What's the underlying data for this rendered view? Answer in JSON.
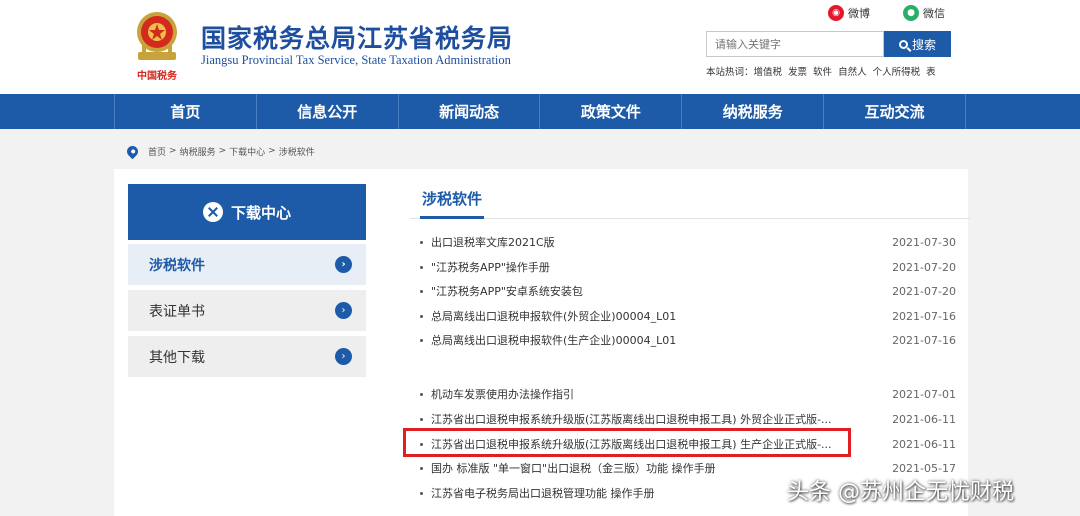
{
  "header": {
    "title": "国家税务总局江苏省税务局",
    "subtitle": "Jiangsu Provincial Tax Service, State Taxation Administration",
    "logo_text": "中国税务",
    "social": [
      {
        "label": "微博",
        "icon": "weibo-icon",
        "color": "#e6162d"
      },
      {
        "label": "微信",
        "icon": "wechat-icon",
        "color": "#2aae67"
      }
    ]
  },
  "search": {
    "placeholder": "请输入关键字",
    "button_label": "搜索",
    "hot_label": "本站热词：",
    "hot_words": [
      "增值税",
      "发票",
      "软件",
      "自然人",
      "个人所得税",
      "表"
    ]
  },
  "nav": {
    "items": [
      "首页",
      "信息公开",
      "新闻动态",
      "政策文件",
      "纳税服务",
      "互动交流"
    ]
  },
  "breadcrumb": {
    "items": [
      "首页",
      "纳税服务",
      "下载中心",
      "涉税软件"
    ],
    "separator": ">"
  },
  "sidebar": {
    "title": "下载中心",
    "items": [
      {
        "label": "涉税软件",
        "active": true
      },
      {
        "label": "表证单书",
        "active": false
      },
      {
        "label": "其他下载",
        "active": false
      }
    ]
  },
  "main": {
    "section_title": "涉税软件",
    "list": [
      {
        "title": "出口退税率文库2021C版",
        "date": "2021-07-30"
      },
      {
        "title": "\"江苏税务APP\"操作手册",
        "date": "2021-07-20"
      },
      {
        "title": "\"江苏税务APP\"安卓系统安装包",
        "date": "2021-07-20"
      },
      {
        "title": "总局离线出口退税申报软件(外贸企业)00004_L01",
        "date": "2021-07-16"
      },
      {
        "title": "总局离线出口退税申报软件(生产企业)00004_L01",
        "date": "2021-07-16"
      },
      {
        "title": "机动车发票使用办法操作指引",
        "date": "2021-07-01"
      },
      {
        "title": "江苏省出口退税申报系统升级版(江苏版离线出口退税申报工具) 外贸企业正式版-...",
        "date": "2021-06-11"
      },
      {
        "title": "江苏省出口退税申报系统升级版(江苏版离线出口退税申报工具) 生产企业正式版-...",
        "date": "2021-06-11"
      },
      {
        "title": "国办 标准版 \"单一窗口\"出口退税（金三版）功能 操作手册",
        "date": "2021-05-17"
      },
      {
        "title": "江苏省电子税务局出口退税管理功能 操作手册",
        "date": ""
      }
    ],
    "highlight_color": "#e02020"
  },
  "watermark": {
    "text": "头条 @苏州企无忧财税"
  },
  "colors": {
    "brand_blue": "#1d5aa8",
    "header_blue": "#1d4f9e",
    "background": "#f2f2f2"
  }
}
